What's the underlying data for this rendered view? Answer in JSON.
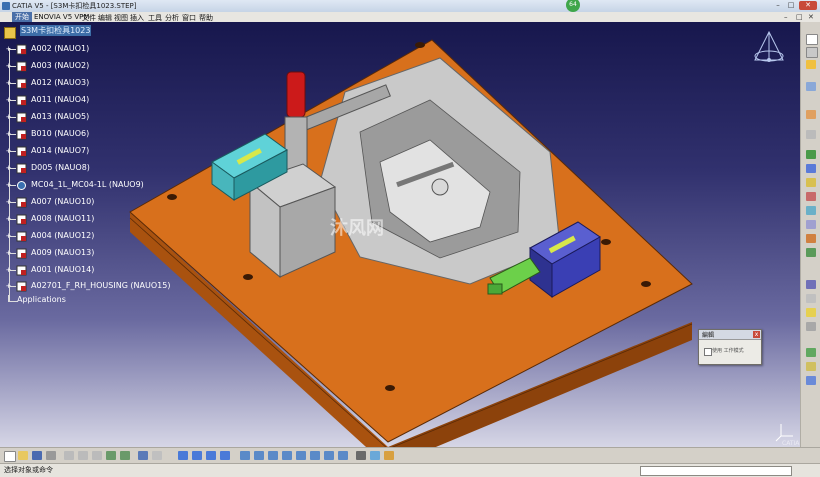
{
  "window": {
    "title": "CATIA V5 - [S3M卡扣检具1023.STEP]",
    "notification_count": "64",
    "minimize": "–",
    "maximize": "□",
    "close": "✕"
  },
  "menubar": {
    "items": [
      "开始",
      "ENOVIA V5 VPM",
      "文件",
      "编辑",
      "视图",
      "插入",
      "工具",
      "分析",
      "窗口",
      "帮助"
    ],
    "right_controls": [
      "–",
      "□",
      "✕"
    ]
  },
  "tree": {
    "root": "S3M卡扣检具1023",
    "nodes": [
      "A002 (NAUO1)",
      "A003 (NAUO2)",
      "A012 (NAUO3)",
      "A011 (NAUO4)",
      "A013 (NAUO5)",
      "B010 (NAUO6)",
      "A014 (NAUO7)",
      "D005 (NAUO8)",
      "MC04_1L_MC04-1L (NAUO9)",
      "A007 (NAUO10)",
      "A008 (NAUO11)",
      "A004 (NAUO12)",
      "A009 (NAUO13)",
      "A001 (NAUO14)",
      "A02701_F_RH_HOUSING (NAUO15)"
    ],
    "applications": "Applications"
  },
  "dialog": {
    "title": "編輯",
    "checkbox_label": "使用 工作模式",
    "close": "x"
  },
  "viewport": {
    "watermark": "沐风网",
    "logo": "CATIA"
  },
  "status": {
    "prompt": "选择对象或命令"
  },
  "colors": {
    "background_top": "#17174d",
    "background_bottom": "#d6d6e6",
    "base_plate": "#d8701c",
    "clamp_red": "#cc1a1a",
    "block_cyan": "#3fc0c8",
    "block_blue": "#3a3fb4",
    "block_green": "#6cd04a",
    "tree_selected": "#3d6ea8"
  }
}
